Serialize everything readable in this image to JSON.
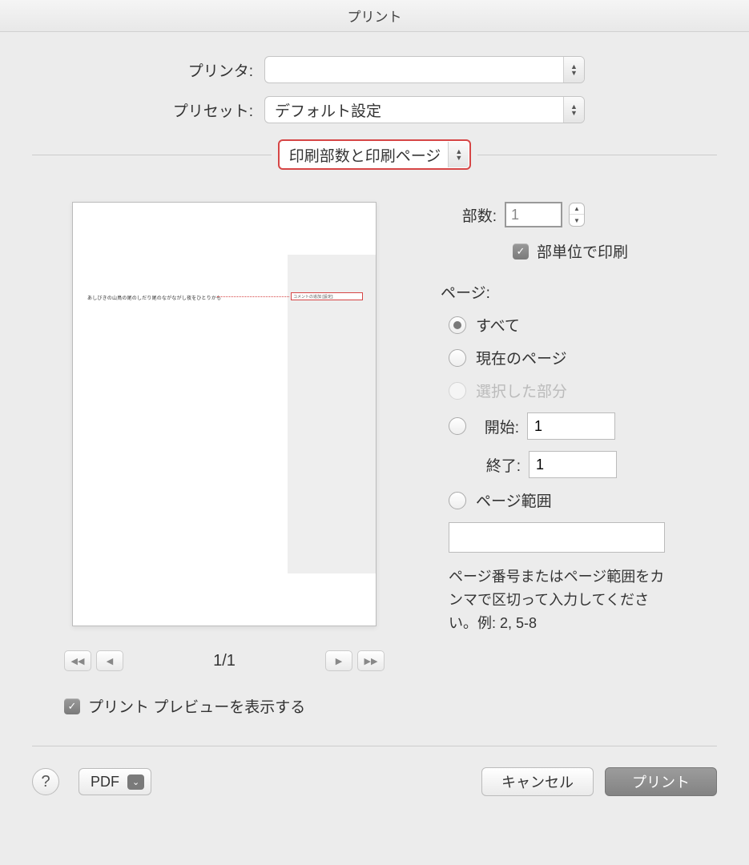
{
  "title": "プリント",
  "labels": {
    "printer": "プリンタ:",
    "preset": "プリセット:",
    "copies": "部数:",
    "collate": "部単位で印刷",
    "pages": "ページ:",
    "start": "開始:",
    "end": "終了:",
    "show_preview": "プリント プレビューを表示する"
  },
  "selects": {
    "printer_value": "",
    "preset_value": "デフォルト設定",
    "pane_value": "印刷部数と印刷ページ"
  },
  "values": {
    "copies": "1",
    "start": "1",
    "end": "1",
    "page_range": "",
    "page_indicator": "1/1"
  },
  "radios": {
    "all": "すべて",
    "current": "現在のページ",
    "selection": "選択した部分",
    "range": "ページ範囲"
  },
  "hint": "ページ番号またはページ範囲をカンマで区切って入力してください。例: 2, 5-8",
  "footer": {
    "pdf": "PDF",
    "cancel": "キャンセル",
    "print": "プリント"
  },
  "preview": {
    "body_text": "あしびきの山鳥の尾のしだり尾のながながし夜をひとりかも",
    "comment_label": "コメントの追加 [設定]:"
  }
}
